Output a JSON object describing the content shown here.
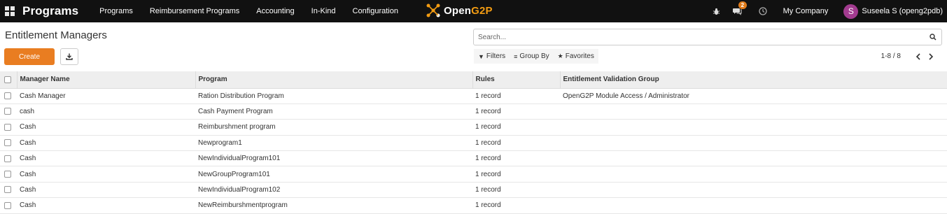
{
  "navbar": {
    "app_title": "Programs",
    "menu": [
      {
        "label": "Programs"
      },
      {
        "label": "Reimbursement Programs"
      },
      {
        "label": "Accounting"
      },
      {
        "label": "In-Kind"
      },
      {
        "label": "Configuration"
      }
    ],
    "brand_prefix": "Open",
    "brand_suffix": "G2P",
    "messages_badge": "2",
    "company": "My Company",
    "user_initial": "S",
    "user_name": "Suseela S (openg2pdb)"
  },
  "control_panel": {
    "title": "Entitlement Managers",
    "create_label": "Create",
    "search_placeholder": "Search...",
    "filters_label": "Filters",
    "group_by_label": "Group By",
    "favorites_label": "Favorites",
    "pager_value": "1-8 / 8"
  },
  "table": {
    "columns": [
      "Manager Name",
      "Program",
      "Rules",
      "Entitlement Validation Group"
    ],
    "rows": [
      {
        "manager": "Cash Manager",
        "program": "Ration Distribution Program",
        "rules": "1 record",
        "group": "OpenG2P Module Access / Administrator"
      },
      {
        "manager": "cash",
        "program": "Cash Payment Program",
        "rules": "1 record",
        "group": ""
      },
      {
        "manager": "Cash",
        "program": "Reimburshment program",
        "rules": "1 record",
        "group": ""
      },
      {
        "manager": "Cash",
        "program": "Newprogram1",
        "rules": "1 record",
        "group": ""
      },
      {
        "manager": "Cash",
        "program": "NewIndividualProgram101",
        "rules": "1 record",
        "group": ""
      },
      {
        "manager": "Cash",
        "program": "NewGroupProgram101",
        "rules": "1 record",
        "group": ""
      },
      {
        "manager": "Cash",
        "program": "NewIndividualProgram102",
        "rules": "1 record",
        "group": ""
      },
      {
        "manager": "Cash",
        "program": "NewReimburshmentprogram",
        "rules": "1 record",
        "group": ""
      }
    ]
  },
  "colors": {
    "navbar_bg": "#111111",
    "primary_button": "#e97d21",
    "avatar": "#a23b8f",
    "brand_accent": "#f39c12"
  },
  "icons": [
    "apps-grid-icon",
    "bug-icon",
    "chat-icon",
    "clock-icon",
    "download-icon",
    "search-icon",
    "filter-icon",
    "group-by-icon",
    "star-icon",
    "chevron-left-icon",
    "chevron-right-icon"
  ]
}
